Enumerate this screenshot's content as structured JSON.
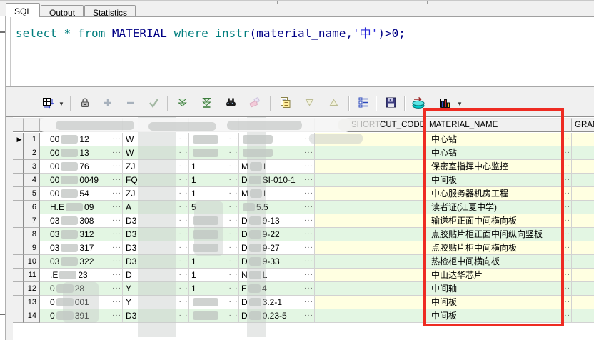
{
  "tabs": [
    {
      "label": "SQL",
      "active": true
    },
    {
      "label": "Output",
      "active": false
    },
    {
      "label": "Statistics",
      "active": false
    }
  ],
  "sql": {
    "tokens": [
      {
        "t": "select ",
        "c": "kw"
      },
      {
        "t": "* ",
        "c": "kw"
      },
      {
        "t": "from ",
        "c": "kw"
      },
      {
        "t": "MATERIAL ",
        "c": "id"
      },
      {
        "t": "where ",
        "c": "kw"
      },
      {
        "t": "instr",
        "c": "kw"
      },
      {
        "t": "(material_name,",
        "c": "id"
      },
      {
        "t": "'中'",
        "c": "str"
      },
      {
        "t": ")>0;",
        "c": "id"
      }
    ]
  },
  "toolbar": {
    "buttons": [
      "grid-view",
      "lock",
      "insert-row",
      "delete-row",
      "commit",
      "fetch-next",
      "fetch-all",
      "find",
      "erase",
      "copy",
      "sort-desc",
      "sort-asc",
      "sort-columns",
      "save",
      "refresh",
      "chart"
    ]
  },
  "grid": {
    "ellipsis": "···",
    "headers": {
      "shortcut_code": "SHORTCUT_CODE",
      "material_name": "MATERIAL_NAME",
      "gram": "GRAM"
    },
    "rows": [
      {
        "n": "1",
        "marker": true,
        "code_l": "00",
        "code_r": "12",
        "type": "W",
        "qty": "",
        "qty_blur": true,
        "spec_l": "",
        "spec_r": "",
        "spec_blur": true,
        "name": "中心钻"
      },
      {
        "n": "2",
        "marker": false,
        "code_l": "00",
        "code_r": "13",
        "type": "W",
        "qty": "",
        "qty_blur": true,
        "spec_l": "",
        "spec_r": "",
        "spec_blur": true,
        "name": "中心钻"
      },
      {
        "n": "3",
        "marker": false,
        "code_l": "00",
        "code_r": "76",
        "type": "ZJ",
        "qty": "1",
        "qty_blur": false,
        "spec_l": "M",
        "spec_r": "L",
        "spec_blur": false,
        "name": "保密室指挥中心监控"
      },
      {
        "n": "4",
        "marker": false,
        "code_l": "00",
        "code_r": "0049",
        "type": "FQ",
        "qty": "1",
        "qty_blur": false,
        "spec_l": "D",
        "spec_r": "SI-010-1",
        "spec_blur": false,
        "name": "中间板"
      },
      {
        "n": "5",
        "marker": false,
        "code_l": "00",
        "code_r": "54",
        "type": "ZJ",
        "qty": "1",
        "qty_blur": false,
        "spec_l": "M",
        "spec_r": "L",
        "spec_blur": false,
        "name": "中心服务器机房工程"
      },
      {
        "n": "6",
        "marker": false,
        "code_l": "H.E",
        "code_r": "09",
        "type": "A",
        "qty": "5",
        "qty_blur": false,
        "spec_l": "",
        "spec_r": "5.5",
        "spec_blur": false,
        "name": "读者证(江夏中学)"
      },
      {
        "n": "7",
        "marker": false,
        "code_l": "03",
        "code_r": "308",
        "type": "D3",
        "qty": "",
        "qty_blur": true,
        "spec_l": "D",
        "spec_r": "9-13",
        "spec_blur": false,
        "name": "输送柜正面中间横向板"
      },
      {
        "n": "8",
        "marker": false,
        "code_l": "03",
        "code_r": "312",
        "type": "D3",
        "qty": "",
        "qty_blur": true,
        "spec_l": "D",
        "spec_r": "9-22",
        "spec_blur": false,
        "name": "点胶贴片柜正面中间纵向竖板"
      },
      {
        "n": "9",
        "marker": false,
        "code_l": "03",
        "code_r": "317",
        "type": "D3",
        "qty": "",
        "qty_blur": true,
        "spec_l": "D",
        "spec_r": "9-27",
        "spec_blur": false,
        "name": "点胶贴片柜中间横向板"
      },
      {
        "n": "10",
        "marker": false,
        "code_l": "03",
        "code_r": "322",
        "type": "D3",
        "qty": "1",
        "qty_blur": false,
        "spec_l": "D",
        "spec_r": "9-33",
        "spec_blur": false,
        "name": "热检柜中间横向板"
      },
      {
        "n": "11",
        "marker": false,
        "code_l": ".E",
        "code_r": "23",
        "type": "D",
        "qty": "1",
        "qty_blur": false,
        "spec_l": "N",
        "spec_r": "L",
        "spec_blur": false,
        "name": "中山达华芯片"
      },
      {
        "n": "12",
        "marker": false,
        "code_l": "0",
        "code_r": "28",
        "type": "Y",
        "qty": "1",
        "qty_blur": false,
        "spec_l": "E",
        "spec_r": "4",
        "spec_blur": false,
        "name": "中间轴"
      },
      {
        "n": "13",
        "marker": false,
        "code_l": "0",
        "code_r": "001",
        "type": "Y",
        "qty": "",
        "qty_blur": true,
        "spec_l": "D",
        "spec_r": "3.2-1",
        "spec_blur": false,
        "name": "中间板"
      },
      {
        "n": "14",
        "marker": false,
        "code_l": "0",
        "code_r": "391",
        "type": "D3",
        "qty": "",
        "qty_blur": true,
        "spec_l": "D",
        "spec_r": "0.23-5",
        "spec_blur": false,
        "name": "中间板"
      }
    ]
  },
  "annotation": {
    "highlight_color": "#ee2b22"
  },
  "colors": {
    "row_green": "#e3f6e3",
    "row_yellow": "#ffffe1",
    "row_white": "#ffffff",
    "keyword": "#007d7d",
    "identifier": "#000085",
    "string_literal": "#2626d8"
  }
}
